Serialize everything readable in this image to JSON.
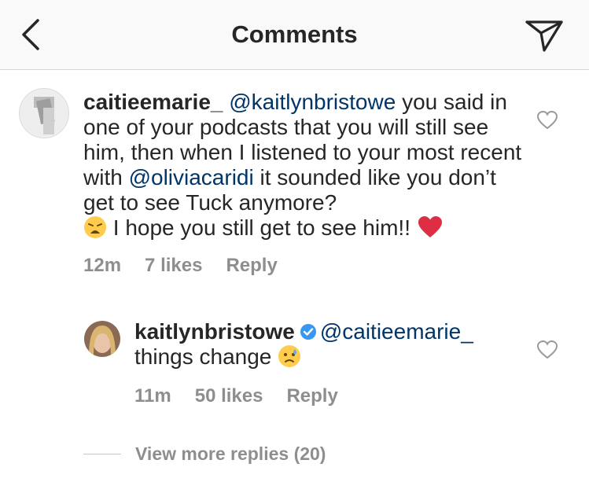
{
  "header": {
    "title": "Comments",
    "back_icon": "chevron-left-icon",
    "send_icon": "paper-plane-icon"
  },
  "comments": [
    {
      "username": "caitieemarie_",
      "mention": "@kaitlynbristowe",
      "text_1": " you said in one of your podcasts that you will still see him, then when I listened to your most recent with ",
      "mention_2": "@oliviacaridi",
      "text_2": " it sounded like you don’t get to see Tuck anymore? ",
      "text_3": " I hope you still get to see him!! ",
      "emoji_1": "weary-face-emoji",
      "emoji_2": "red-heart-emoji",
      "time": "12m",
      "likes": "7 likes",
      "reply_label": "Reply"
    },
    {
      "username": "kaitlynbristowe",
      "verified": true,
      "mention": "@caitieemarie_",
      "text_1": "things change ",
      "emoji_1": "sad-relieved-face-emoji",
      "time": "11m",
      "likes": "50 likes",
      "reply_label": "Reply"
    }
  ],
  "view_more": "View more replies (20)",
  "colors": {
    "mention": "#003569",
    "meta": "#8e8e8e",
    "verified": "#3897f0",
    "header_bg": "#f9f9f9"
  }
}
